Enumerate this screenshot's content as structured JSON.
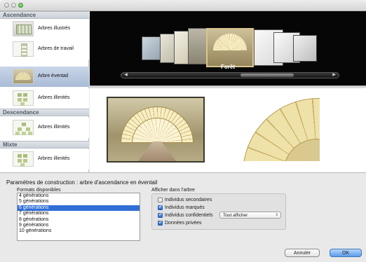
{
  "sidebar": {
    "sections": [
      {
        "title": "Ascendance",
        "items": [
          {
            "label": "Arbres illustrés",
            "icon": "illustrated-tree-icon"
          },
          {
            "label": "Arbres de travail",
            "icon": "working-tree-icon"
          },
          {
            "label": "Arbre éventail",
            "icon": "fan-chart-icon"
          },
          {
            "label": "Arbres illimités",
            "icon": "unlimited-tree-icon"
          }
        ]
      },
      {
        "title": "Descendance",
        "items": [
          {
            "label": "Arbres illimités",
            "icon": "descendant-tree-icon"
          }
        ]
      },
      {
        "title": "Mixte",
        "items": [
          {
            "label": "Arbres illimités",
            "icon": "mixed-tree-icon"
          }
        ]
      }
    ],
    "selected": "Arbre éventail"
  },
  "coverflow": {
    "current_label": "Forêt"
  },
  "build": {
    "title": "Paramètres de construction : arbre d'ascendance en éventail",
    "formats_label": "Formats disponibles",
    "formats": [
      "4 générations",
      "5 générations",
      "6 générations",
      "7 générations",
      "8 générations",
      "9 générations",
      "10 générations"
    ],
    "selected_format": "6 générations",
    "display_label": "Afficher dans l'arbre",
    "options": [
      {
        "label": "Individus secondaires",
        "checked": false
      },
      {
        "label": "Individus marqués",
        "checked": true
      },
      {
        "label": "Individus confidentiels",
        "checked": true
      },
      {
        "label": "Données privées",
        "checked": true
      }
    ],
    "confidential_select": "Tout afficher"
  },
  "buttons": {
    "cancel": "Annuler",
    "ok": "OK"
  },
  "colors": {
    "selection": "#2f6fd6",
    "sidebar_selection": "#a9bbd6",
    "coverflow_bg": "#060606"
  }
}
